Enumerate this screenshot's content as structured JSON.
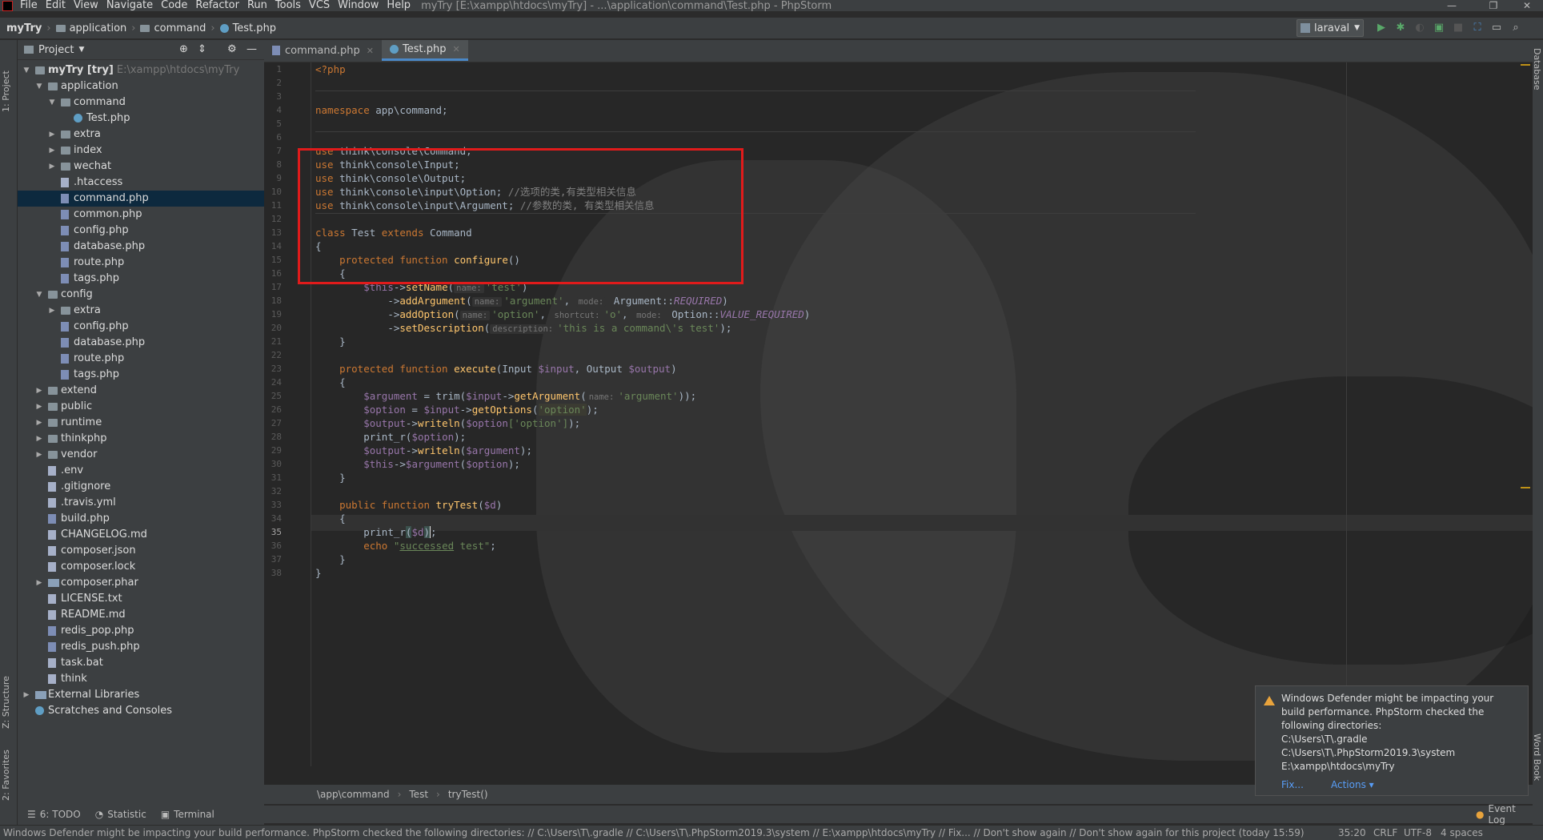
{
  "menubar": {
    "items": [
      "File",
      "Edit",
      "View",
      "Navigate",
      "Code",
      "Refactor",
      "Run",
      "Tools",
      "VCS",
      "Window",
      "Help"
    ],
    "window_title": "myTry [E:\\xampp\\htdocs\\myTry] - ...\\application\\command\\Test.php - PhpStorm"
  },
  "navbar": {
    "crumbs": [
      "myTry",
      "application",
      "command",
      "Test.php"
    ],
    "run_config": "laraval"
  },
  "left_strip": {
    "project_tab": "1: Project",
    "structure_tab": "Z: Structure",
    "favorites_tab": "2: Favorites"
  },
  "right_strip": {
    "database_tab": "Database",
    "wordbook_tab": "Word Book"
  },
  "project_panel": {
    "title": "Project",
    "tree": [
      {
        "label": "myTry [try]",
        "extra": "E:\\xampp\\htdocs\\myTry",
        "icon": "folder-icon",
        "depth": 0,
        "arrow": "down"
      },
      {
        "label": "application",
        "icon": "folder-icon",
        "depth": 1,
        "arrow": "down"
      },
      {
        "label": "command",
        "icon": "folder-icon",
        "depth": 2,
        "arrow": "down"
      },
      {
        "label": "Test.php",
        "icon": "php-class-icon",
        "depth": 3,
        "arrow": ""
      },
      {
        "label": "extra",
        "icon": "folder-icon",
        "depth": 2,
        "arrow": "right"
      },
      {
        "label": "index",
        "icon": "folder-icon",
        "depth": 2,
        "arrow": "right"
      },
      {
        "label": "wechat",
        "icon": "folder-icon",
        "depth": 2,
        "arrow": "right"
      },
      {
        "label": ".htaccess",
        "icon": "file-icon",
        "depth": 2,
        "arrow": ""
      },
      {
        "label": "command.php",
        "icon": "php-file-icon",
        "depth": 2,
        "arrow": "",
        "selected": true
      },
      {
        "label": "common.php",
        "icon": "php-file-icon",
        "depth": 2,
        "arrow": ""
      },
      {
        "label": "config.php",
        "icon": "php-file-icon",
        "depth": 2,
        "arrow": ""
      },
      {
        "label": "database.php",
        "icon": "php-file-icon",
        "depth": 2,
        "arrow": ""
      },
      {
        "label": "route.php",
        "icon": "php-file-icon",
        "depth": 2,
        "arrow": ""
      },
      {
        "label": "tags.php",
        "icon": "php-file-icon",
        "depth": 2,
        "arrow": ""
      },
      {
        "label": "config",
        "icon": "folder-icon",
        "depth": 1,
        "arrow": "down"
      },
      {
        "label": "extra",
        "icon": "folder-icon",
        "depth": 2,
        "arrow": "right"
      },
      {
        "label": "config.php",
        "icon": "php-file-icon",
        "depth": 2,
        "arrow": ""
      },
      {
        "label": "database.php",
        "icon": "php-file-icon",
        "depth": 2,
        "arrow": ""
      },
      {
        "label": "route.php",
        "icon": "php-file-icon",
        "depth": 2,
        "arrow": ""
      },
      {
        "label": "tags.php",
        "icon": "php-file-icon",
        "depth": 2,
        "arrow": ""
      },
      {
        "label": "extend",
        "icon": "folder-icon",
        "depth": 1,
        "arrow": "right"
      },
      {
        "label": "public",
        "icon": "folder-icon",
        "depth": 1,
        "arrow": "right"
      },
      {
        "label": "runtime",
        "icon": "folder-icon",
        "depth": 1,
        "arrow": "right"
      },
      {
        "label": "thinkphp",
        "icon": "folder-icon",
        "depth": 1,
        "arrow": "right"
      },
      {
        "label": "vendor",
        "icon": "folder-icon",
        "depth": 1,
        "arrow": "right"
      },
      {
        "label": ".env",
        "icon": "file-icon",
        "depth": 1,
        "arrow": ""
      },
      {
        "label": ".gitignore",
        "icon": "file-icon",
        "depth": 1,
        "arrow": ""
      },
      {
        "label": ".travis.yml",
        "icon": "file-icon",
        "depth": 1,
        "arrow": ""
      },
      {
        "label": "build.php",
        "icon": "php-file-icon",
        "depth": 1,
        "arrow": ""
      },
      {
        "label": "CHANGELOG.md",
        "icon": "file-icon",
        "depth": 1,
        "arrow": ""
      },
      {
        "label": "composer.json",
        "icon": "file-icon",
        "depth": 1,
        "arrow": ""
      },
      {
        "label": "composer.lock",
        "icon": "file-icon",
        "depth": 1,
        "arrow": ""
      },
      {
        "label": "composer.phar",
        "icon": "archive-icon",
        "depth": 1,
        "arrow": "right"
      },
      {
        "label": "LICENSE.txt",
        "icon": "file-icon",
        "depth": 1,
        "arrow": ""
      },
      {
        "label": "README.md",
        "icon": "file-icon",
        "depth": 1,
        "arrow": ""
      },
      {
        "label": "redis_pop.php",
        "icon": "php-file-icon",
        "depth": 1,
        "arrow": ""
      },
      {
        "label": "redis_push.php",
        "icon": "php-file-icon",
        "depth": 1,
        "arrow": ""
      },
      {
        "label": "task.bat",
        "icon": "file-icon",
        "depth": 1,
        "arrow": ""
      },
      {
        "label": "think",
        "icon": "file-icon",
        "depth": 1,
        "arrow": ""
      },
      {
        "label": "External Libraries",
        "icon": "library-icon",
        "depth": 0,
        "arrow": "right"
      },
      {
        "label": "Scratches and Consoles",
        "icon": "scratch-icon",
        "depth": 0,
        "arrow": ""
      }
    ]
  },
  "editor": {
    "tabs": [
      {
        "label": "command.php",
        "active": false
      },
      {
        "label": "Test.php",
        "active": true
      }
    ],
    "current_line": 35,
    "line_count": 38,
    "breadcrumb": [
      "\\app\\command",
      "Test",
      "tryTest()"
    ]
  },
  "code_tokens": {
    "l1": "<?php",
    "l5a": "namespace",
    "l5b": " app\\command;",
    "use": "use",
    "l8": " think\\console\\Command;",
    "l9": " think\\console\\Input;",
    "l10": " think\\console\\Output;",
    "l11": " think\\console\\input\\Option; ",
    "l11c": "//选项的类,有类型相关信息",
    "l12": " think\\console\\input\\Argument; ",
    "l12c": "//参数的类, 有类型相关信息",
    "class": "class",
    "l14a": " Test ",
    "extends": "extends",
    "l14b": " Command",
    "brace_open": "{",
    "brace_close": "}",
    "protected": "protected",
    "function": " function ",
    "configure": "configure",
    "paren": "()",
    "this": "$this",
    "arrow": "->",
    "setName": "setName",
    "hint_name": "name:",
    "s_test": "'test'",
    "close_paren": ")",
    "addArgument": "addArgument",
    "s_argument": "'argument'",
    "hint_mode": "mode:",
    "argument_cls": " Argument::",
    "REQUIRED": "REQUIRED",
    "addOption": "addOption",
    "s_option": "'option'",
    "hint_shortcut": "shortcut:",
    "s_o": "'o'",
    "option_cls": " Option::",
    "VALUE_REQUIRED": "VALUE_REQUIRED",
    "setDescription": "setDescription",
    "hint_description": "description:",
    "s_desc": "'this is a command\\'s test'",
    "end_stmt": ");",
    "execute": "execute",
    "exec_params_a": "(Input ",
    "input_var": "$input",
    "exec_params_b": ", Output ",
    "output_var": "$output",
    "exec_params_c": ")",
    "argument_var": "$argument",
    "eq_trim": " = trim(",
    "getArgument": "getArgument",
    "end_double": "));",
    "option_var": "$option",
    "eq": " = ",
    "getOptions": "getOptions",
    "open_paren": "(",
    "writeln": "writeln",
    "idx_option": "['option']",
    "print_r": "print_r",
    "public": "public",
    "tryTest": "tryTest",
    "d_var": "$d",
    "echo": "echo",
    "s_successed_a": "\"",
    "successed": "successed",
    "s_successed_b": " test\"",
    "semicolon": ";",
    "comma": ", ",
    "argument_prop": "$argument"
  },
  "tool_windows": [
    "6: TODO",
    "Statistic",
    "Terminal",
    "Event Log"
  ],
  "notification": {
    "lines": [
      "Windows Defender might be impacting your",
      "build performance. PhpStorm checked the",
      "following directories:",
      "C:\\Users\\T\\.gradle",
      "C:\\Users\\T\\.PhpStorm2019.3\\system",
      "E:\\xampp\\htdocs\\myTry"
    ],
    "fix_link": "Fix...",
    "actions_link": "Actions ▾"
  },
  "statusbar": {
    "message": "Windows Defender might be impacting your build performance. PhpStorm checked the following directories: // C:\\Users\\T\\.gradle // C:\\Users\\T\\.PhpStorm2019.3\\system // E:\\xampp\\htdocs\\myTry // Fix... // Don't show again // Don't show again for this project (today 15:59)",
    "position": "35:20",
    "line_sep": "CRLF",
    "encoding": "UTF-8",
    "indent": "4 spaces"
  },
  "colors": {
    "accent": "#4a88c7",
    "highlight_box": "#e01b1b",
    "keyword": "#cc7832",
    "string": "#6a8759",
    "function": "#ffc66d",
    "variable": "#9876aa"
  }
}
